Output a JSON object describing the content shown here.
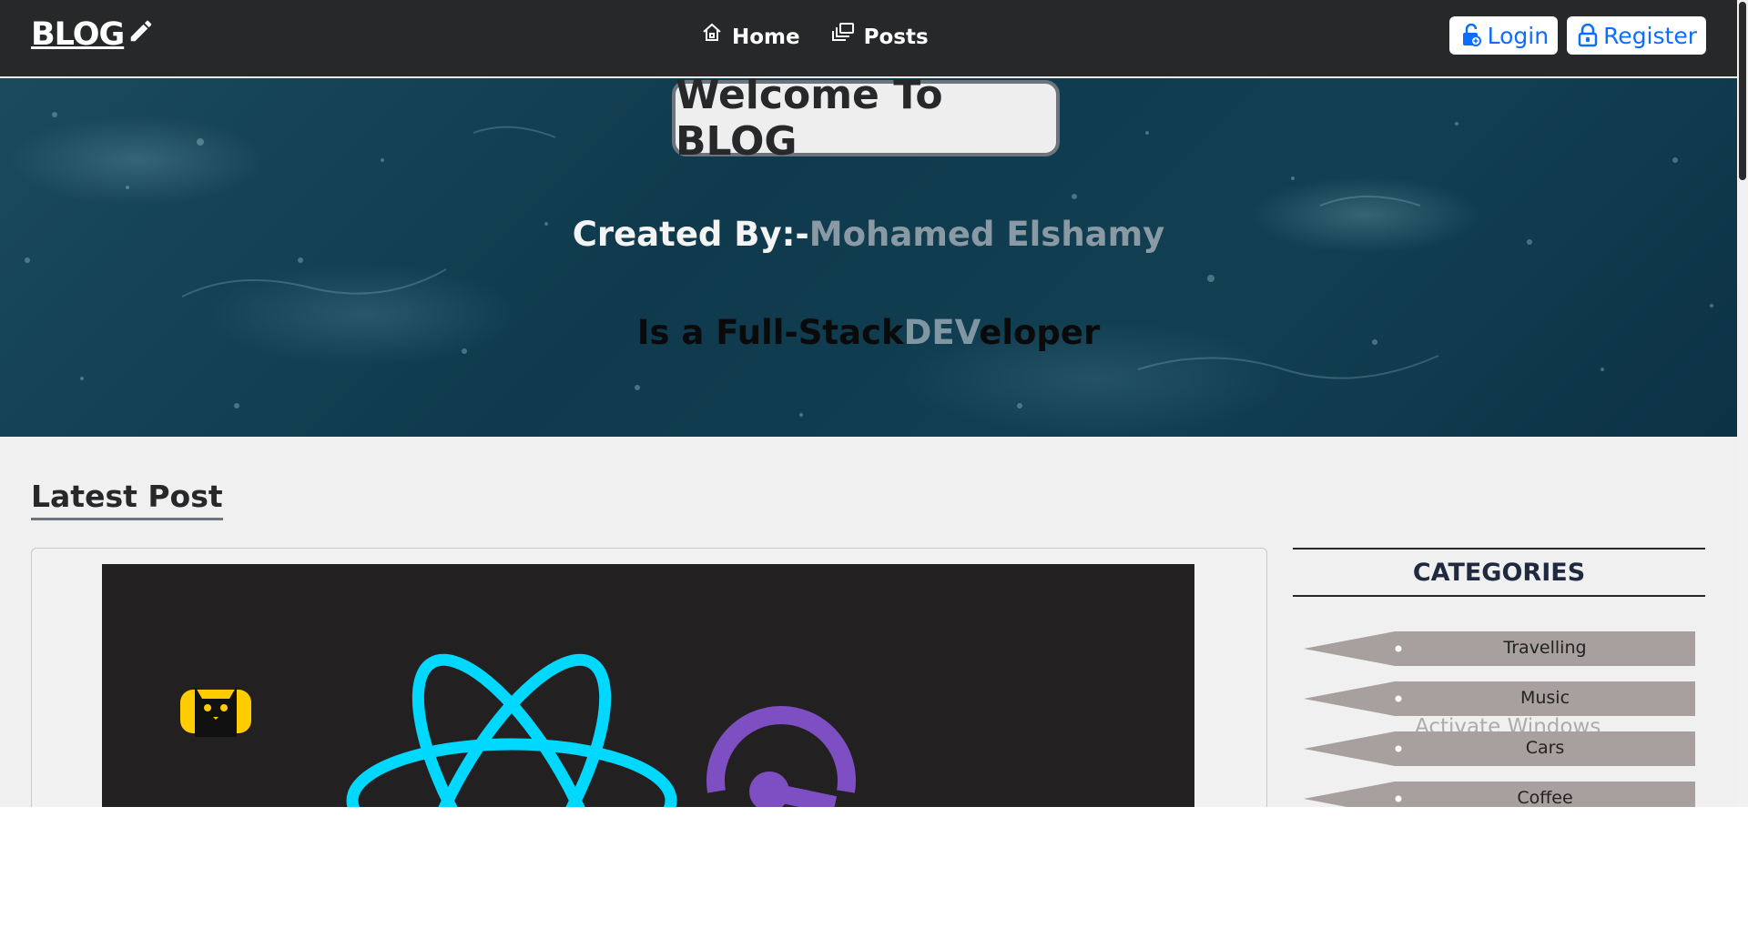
{
  "navbar": {
    "brand": "BLOG",
    "links": [
      {
        "label": "Home",
        "icon": "home-icon"
      },
      {
        "label": "Posts",
        "icon": "posts-icon"
      }
    ],
    "login_label": "Login",
    "register_label": "Register"
  },
  "hero": {
    "welcome": "Welcome To BLOG",
    "created_prefix": "Created By:-",
    "created_name": "Mohamed Elshamy",
    "role_prefix": "Is a Full-Stack",
    "role_highlight": "DEV",
    "role_suffix": "eloper"
  },
  "main": {
    "section_title": "Latest Post"
  },
  "sidebar": {
    "title": "CATEGORIES",
    "items": [
      {
        "label": "Travelling"
      },
      {
        "label": "Music"
      },
      {
        "label": "Cars"
      },
      {
        "label": "Coffee"
      }
    ]
  },
  "watermark": "Activate Windows",
  "colors": {
    "navbar_bg": "#272829",
    "accent_blue": "#0d6efd",
    "category_tag": "#a7a09f",
    "react_logo": "#00d8ff",
    "purple_logo": "#7e4fc2"
  }
}
